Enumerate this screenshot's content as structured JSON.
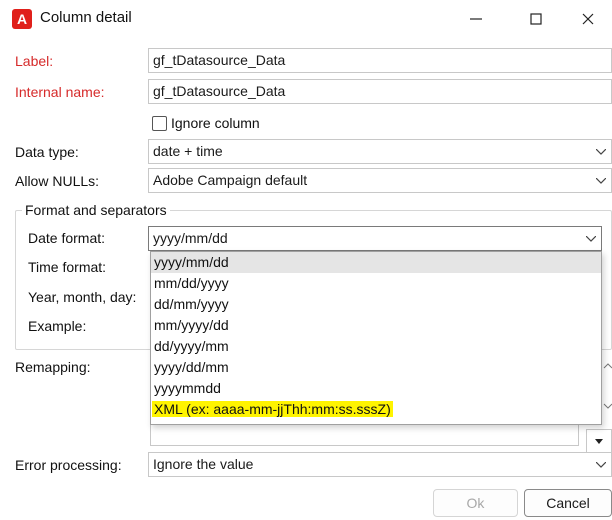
{
  "window": {
    "title": "Column detail",
    "app_icon_glyph": "A",
    "controls": {
      "minimize": "—",
      "maximize": "☐",
      "close": "✕"
    }
  },
  "form": {
    "label": {
      "caption": "Label:",
      "value": "gf_tDatasource_Data"
    },
    "internal_name": {
      "caption": "Internal name:",
      "value": "gf_tDatasource_Data"
    },
    "ignore_column": {
      "caption": "Ignore column",
      "checked": false
    },
    "data_type": {
      "caption": "Data type:",
      "value": "date + time"
    },
    "allow_nulls": {
      "caption": "Allow NULLs:",
      "value": "Adobe Campaign default"
    },
    "format_group": {
      "legend": "Format and separators",
      "date_format": {
        "caption": "Date format:",
        "value": "yyyy/mm/dd"
      },
      "time_format": {
        "caption": "Time format:"
      },
      "ymd": {
        "caption": "Year, month, day:"
      },
      "example": {
        "caption": "Example:"
      }
    },
    "remapping": {
      "caption": "Remapping:"
    },
    "error_processing": {
      "caption": "Error processing:",
      "value": "Ignore the value"
    }
  },
  "date_format_options": [
    "yyyy/mm/dd",
    "mm/dd/yyyy",
    "dd/mm/yyyy",
    "mm/yyyy/dd",
    "dd/yyyy/mm",
    "yyyy/dd/mm",
    "yyyymmdd",
    "XML (ex: aaaa-mm-jjThh:mm:ss.sssZ)"
  ],
  "selected_option_index": 0,
  "highlighted_option_index": 7,
  "buttons": {
    "ok": "Ok",
    "cancel": "Cancel"
  },
  "colors": {
    "required_label": "#d62a2a",
    "app_icon": "#e0201b",
    "highlight": "#fff400"
  },
  "icons": {
    "dropdown": "chevron-down-icon"
  }
}
